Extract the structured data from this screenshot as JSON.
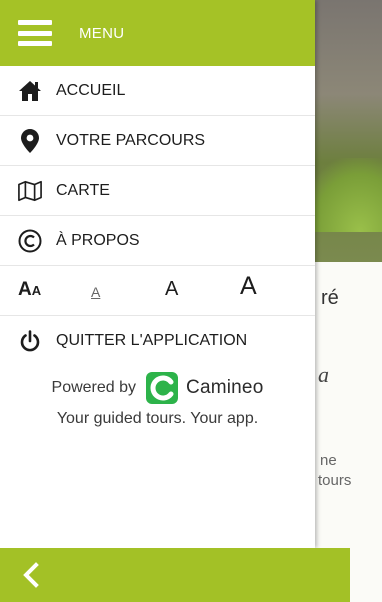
{
  "drawer": {
    "title": "MENU",
    "items": [
      {
        "icon": "home-icon",
        "label": "ACCUEIL"
      },
      {
        "icon": "map-pin-icon",
        "label": "VOTRE PARCOURS"
      },
      {
        "icon": "map-icon",
        "label": "CARTE"
      },
      {
        "icon": "copyright-icon",
        "label": "À PROPOS"
      }
    ],
    "font_size": {
      "icon_big": "A",
      "icon_small": "A",
      "small": "A",
      "medium": "A",
      "large": "A"
    },
    "quit_label": "QUITTER L'APPLICATION"
  },
  "powered": {
    "by": "Powered by",
    "brand": "Camineo",
    "tagline": "Your guided tours. Your app."
  },
  "background": {
    "fragment_1": "ré",
    "fragment_2": "a",
    "fragment_3": "ne",
    "fragment_4": "tours"
  },
  "colors": {
    "accent": "#a5c226",
    "text": "#1d1d1d"
  }
}
